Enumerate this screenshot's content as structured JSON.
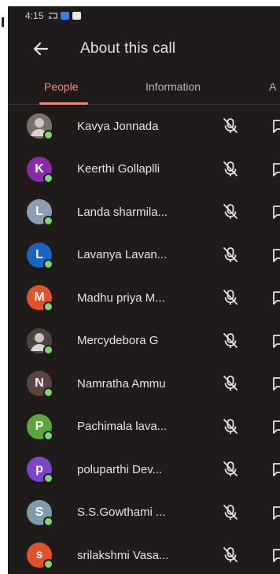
{
  "status": {
    "time": "4:15"
  },
  "header": {
    "title": "About this call"
  },
  "tabs": [
    {
      "label": "People"
    },
    {
      "label": "Information"
    },
    {
      "label": "A"
    }
  ],
  "participants": [
    {
      "name": "Kavya Jonnada",
      "avatar_type": "photo",
      "avatar_color": "#7b6f6b",
      "initial": ""
    },
    {
      "name": "Keerthi Gollaplli",
      "avatar_type": "initial",
      "avatar_color": "#8a2aa8",
      "initial": "K"
    },
    {
      "name": "Landa sharmila...",
      "avatar_type": "initial",
      "avatar_color": "#8aa0b2",
      "initial": "L"
    },
    {
      "name": "Lavanya Lavan...",
      "avatar_type": "initial",
      "avatar_color": "#1a63c2",
      "initial": "L"
    },
    {
      "name": "Madhu priya M...",
      "avatar_type": "initial",
      "avatar_color": "#e0512c",
      "initial": "M"
    },
    {
      "name": "Mercydebora G",
      "avatar_type": "photo",
      "avatar_color": "#4a4545",
      "initial": ""
    },
    {
      "name": "Namratha Ammu",
      "avatar_type": "initial",
      "avatar_color": "#5c4444",
      "initial": "N"
    },
    {
      "name": "Pachimala lava...",
      "avatar_type": "initial",
      "avatar_color": "#5da63c",
      "initial": "P"
    },
    {
      "name": "poluparthi Dev...",
      "avatar_type": "initial",
      "avatar_color": "#7b46c9",
      "initial": "p"
    },
    {
      "name": "S.S.Gowthami ...",
      "avatar_type": "initial",
      "avatar_color": "#7f9aa9",
      "initial": "S"
    },
    {
      "name": "srilakshmi Vasa...",
      "avatar_type": "initial",
      "avatar_color": "#e0512c",
      "initial": "s"
    }
  ],
  "icons": {
    "mic": "mic-off-icon",
    "row_action": "more-icon"
  },
  "colors": {
    "accent": "#f08b86",
    "online": "#7bd86f"
  }
}
